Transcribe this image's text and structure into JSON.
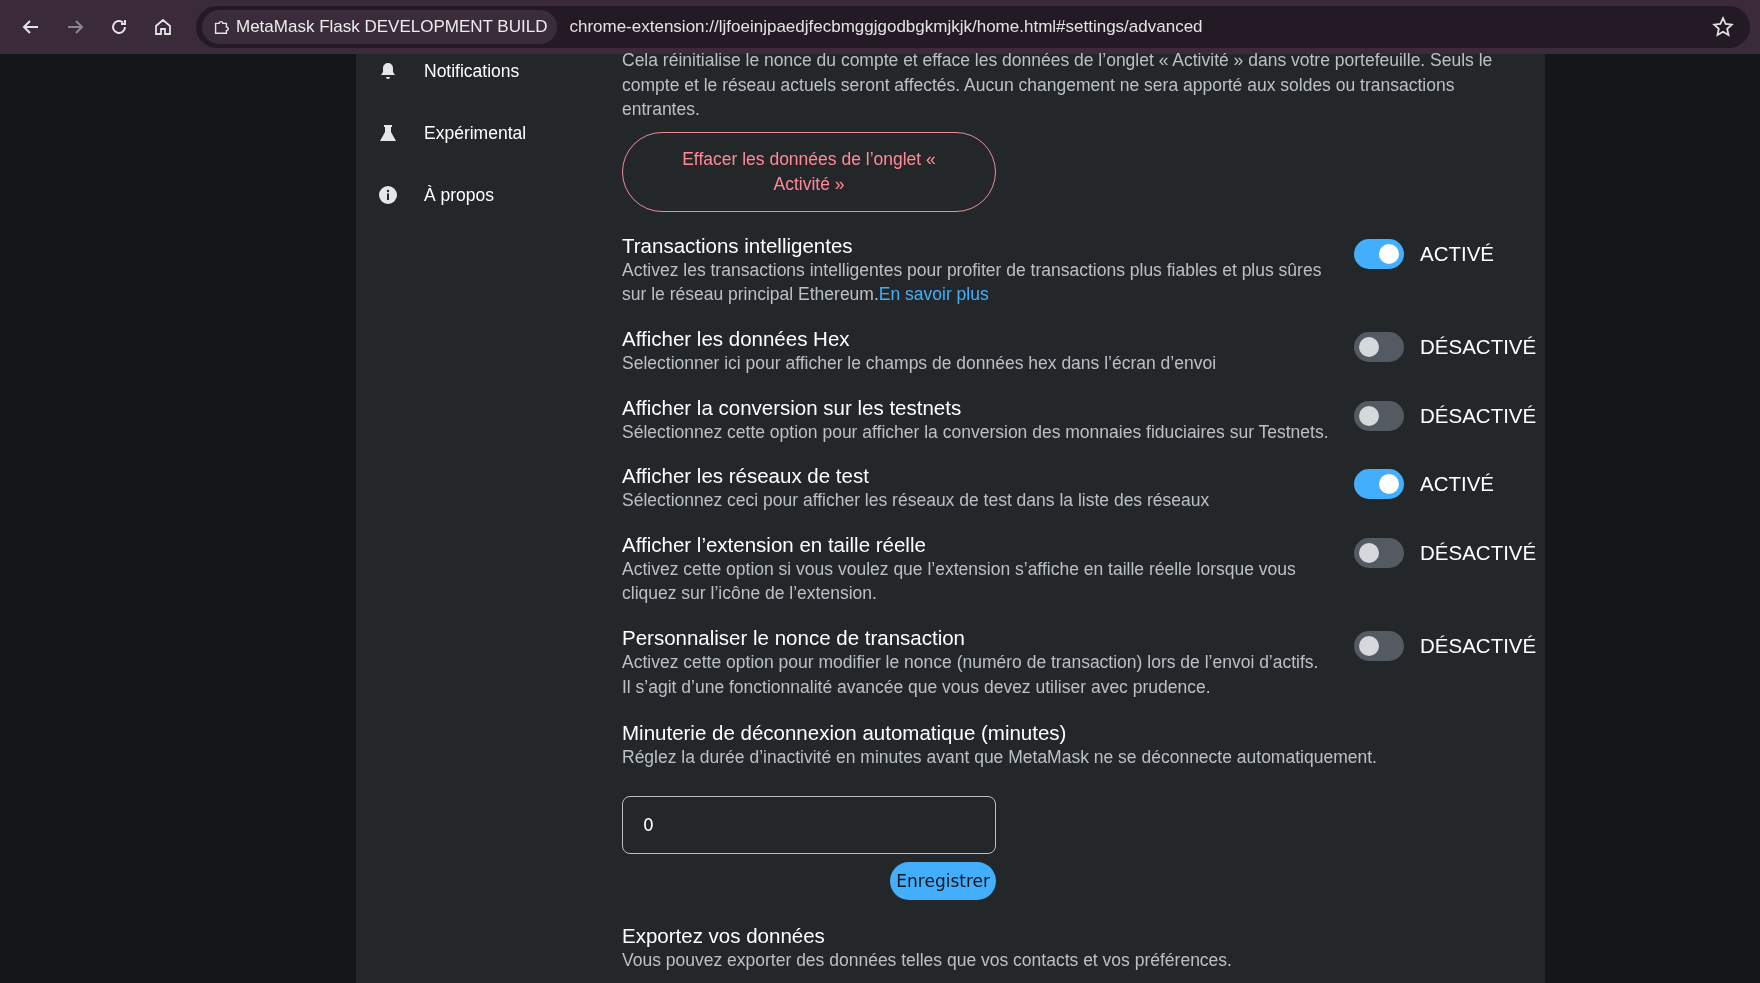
{
  "browser": {
    "tab_label": "MetaMask Flask DEVELOPMENT BUILD",
    "url": "chrome-extension://ljfoeinjpaedjfecbmggjgodbgkmjkjk/home.html#settings/advanced"
  },
  "sidebar": {
    "items": [
      {
        "label": "Notifications",
        "kind": "bell"
      },
      {
        "label": "Expérimental",
        "kind": "flask"
      },
      {
        "label": "À propos",
        "kind": "info"
      }
    ]
  },
  "content": {
    "intro": "Cela réinitialise le nonce du compte et efface les données de l’onglet « Activité » dans votre portefeuille. Seuls le compte et le réseau actuels seront affectés. Aucun changement ne sera apporté aux soldes ou transactions entrantes.",
    "clear_button": "Effacer les données de l’onglet « Activité »",
    "settings": [
      {
        "title": "Transactions intelligentes",
        "description": "Activez les transactions intelligentes pour profiter de transactions plus fiables et plus sûres sur le réseau principal Ethereum.",
        "link": "En savoir plus",
        "on": true,
        "state_label": "ACTIVÉ"
      },
      {
        "title": "Afficher les données Hex",
        "description": "Selectionner ici pour afficher le champs de données hex dans l’écran d’envoi",
        "on": false,
        "state_label": "DÉSACTIVÉ"
      },
      {
        "title": "Afficher la conversion sur les testnets",
        "description": "Sélectionnez cette option pour afficher la conversion des monnaies fiduciaires sur Testnets.",
        "on": false,
        "state_label": "DÉSACTIVÉ"
      },
      {
        "title": "Afficher les réseaux de test",
        "description": "Sélectionnez ceci pour afficher les réseaux de test dans la liste des réseaux",
        "on": true,
        "state_label": "ACTIVÉ"
      },
      {
        "title": "Afficher l’extension en taille réelle",
        "description": "Activez cette option si vous voulez que l’extension s’affiche en taille réelle lorsque vous cliquez sur l’icône de l’extension.",
        "on": false,
        "state_label": "DÉSACTIVÉ"
      },
      {
        "title": "Personnaliser le nonce de transaction",
        "description": "Activez cette option pour modifier le nonce (numéro de transaction) lors de l’envoi d’actifs. Il s’agit d’une fonctionnalité avancée que vous devez utiliser avec prudence.",
        "on": false,
        "state_label": "DÉSACTIVÉ"
      }
    ],
    "timer": {
      "title": "Minuterie de déconnexion automatique (minutes)",
      "description": "Réglez la durée d’inactivité en minutes avant que MetaMask ne se déconnecte automatiquement.",
      "value": "0",
      "save_button": "Enregistrer"
    },
    "export": {
      "title": "Exportez vos données",
      "description": "Vous pouvez exporter des données telles que vos contacts et vos préférences."
    }
  }
}
